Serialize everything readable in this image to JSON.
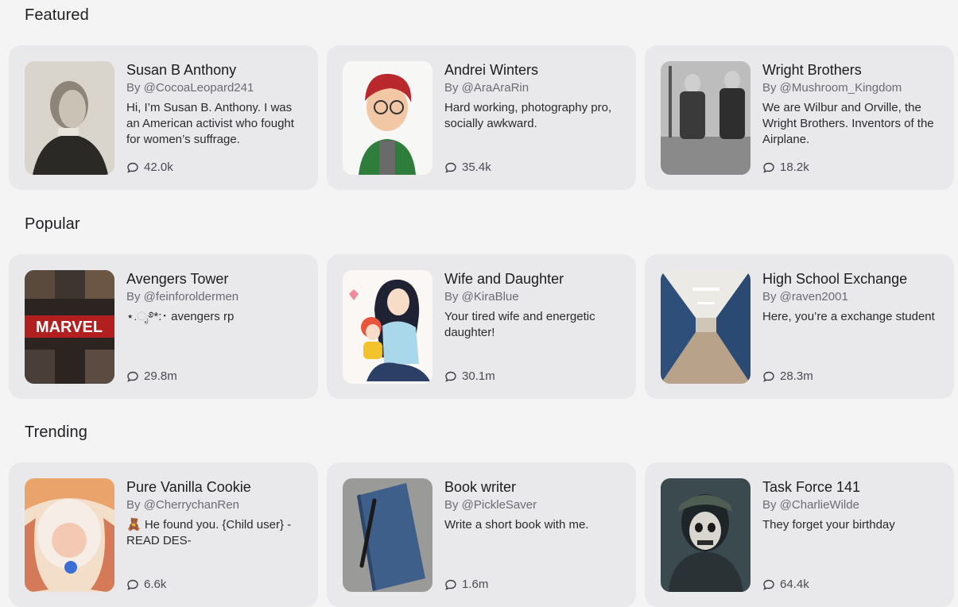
{
  "sections": [
    {
      "title": "Featured",
      "cards": [
        {
          "name": "Susan B Anthony",
          "author": "By @CocoaLeopard241",
          "description": "Hi, I’m Susan B. Anthony. I was an American activist who fought for women’s suffrage.",
          "chats": "42.0k"
        },
        {
          "name": "Andrei Winters",
          "author": "By @AraAraRin",
          "description": "Hard working, photography pro, socially awkward.",
          "chats": "35.4k"
        },
        {
          "name": "Wright Brothers",
          "author": "By @Mushroom_Kingdom",
          "description": "We are Wilbur and Orville, the Wright Brothers. Inventors of the Airplane.",
          "chats": "18.2k"
        }
      ]
    },
    {
      "title": "Popular",
      "cards": [
        {
          "name": "Avengers Tower",
          "author": "By @feinforoldermen",
          "description": "⋆.ೃ࿔*:･ avengers rp",
          "chats": "29.8m"
        },
        {
          "name": "Wife and Daughter",
          "author": "By @KiraBlue",
          "description": "Your tired wife and energetic daughter!",
          "chats": "30.1m"
        },
        {
          "name": "High School Exchange",
          "author": "By @raven2001",
          "description": "Here, you’re a exchange student",
          "chats": "28.3m"
        }
      ]
    },
    {
      "title": "Trending",
      "cards": [
        {
          "name": "Pure Vanilla Cookie",
          "author": "By @CherrychanRen",
          "description": "🧸 He found you. {Child user} - READ DES-",
          "chats": "6.6k"
        },
        {
          "name": "Book writer",
          "author": "By @PickleSaver",
          "description": "Write a short book with me.",
          "chats": "1.6m"
        },
        {
          "name": "Task Force 141",
          "author": "By @CharlieWilde",
          "description": "They forget your birthday",
          "chats": "64.4k"
        }
      ]
    }
  ],
  "icons": {
    "chat": "chat-bubble-icon"
  }
}
